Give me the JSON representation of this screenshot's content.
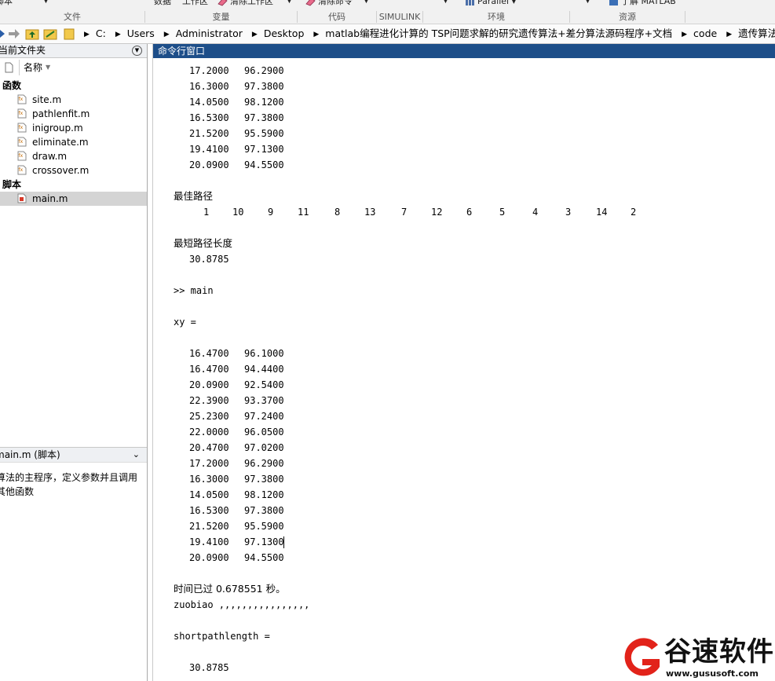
{
  "colors": {
    "accent": "#1d4e89",
    "selected": "#d4d4d4",
    "logo_red": "#e2231a"
  },
  "ribbon": {
    "items": [
      {
        "label": "脚本",
        "icon": "script-icon"
      },
      {
        "label": "数据",
        "icon": ""
      },
      {
        "label": "工作区",
        "icon": ""
      },
      {
        "label": "清除工作区",
        "icon": "eraser-icon"
      },
      {
        "label": "清除命令",
        "icon": "eraser-icon"
      },
      {
        "label": "Parallel",
        "icon": "parallel-icon"
      },
      {
        "label": "了解 MATLAB",
        "icon": "learn-icon"
      }
    ],
    "groups": [
      "文件",
      "变量",
      "代码",
      "SIMULINK",
      "环境",
      "资源"
    ]
  },
  "address": {
    "crumbs": [
      "C:",
      "Users",
      "Administrator",
      "Desktop",
      "matlab编程进化计算的 TSP问题求解的研究遗传算法+差分算法源码程序+文档",
      "code",
      "遗传算法"
    ]
  },
  "left_panel": {
    "title": "当前文件夹",
    "column": "名称",
    "groups": [
      {
        "label": "函数",
        "files": [
          "site.m",
          "pathlenfit.m",
          "inigroup.m",
          "eliminate.m",
          "draw.m",
          "crossover.m"
        ]
      },
      {
        "label": "脚本",
        "files": [
          "main.m"
        ]
      }
    ],
    "details_title": "main.m  (脚本)",
    "details_text": [
      "算法的主程序，定义参数并且调用",
      "其他函数"
    ]
  },
  "command_window": {
    "title": "命令行窗口",
    "top_rows": [
      [
        "17.2000",
        "96.2900"
      ],
      [
        "16.3000",
        "97.3800"
      ],
      [
        "14.0500",
        "98.1200"
      ],
      [
        "16.5300",
        "97.3800"
      ],
      [
        "21.5200",
        "95.5900"
      ],
      [
        "19.4100",
        "97.1300"
      ],
      [
        "20.0900",
        "94.5500"
      ]
    ],
    "best_path_label": "最佳路径",
    "best_path": [
      "1",
      "10",
      "9",
      "11",
      "8",
      "13",
      "7",
      "12",
      "6",
      "5",
      "4",
      "3",
      "14",
      "2"
    ],
    "shortest_label": "最短路径长度",
    "shortest_value": "30.8785",
    "command": ">> main",
    "xy_label": "xy =",
    "xy_rows": [
      [
        "16.4700",
        "96.1000"
      ],
      [
        "16.4700",
        "94.4400"
      ],
      [
        "20.0900",
        "92.5400"
      ],
      [
        "22.3900",
        "93.3700"
      ],
      [
        "25.2300",
        "97.2400"
      ],
      [
        "22.0000",
        "96.0500"
      ],
      [
        "20.4700",
        "97.0200"
      ],
      [
        "17.2000",
        "96.2900"
      ],
      [
        "16.3000",
        "97.3800"
      ],
      [
        "14.0500",
        "98.1200"
      ],
      [
        "16.5300",
        "97.3800"
      ],
      [
        "21.5200",
        "95.5900"
      ],
      [
        "19.4100",
        "97.1300"
      ],
      [
        "20.0900",
        "94.5500"
      ]
    ],
    "elapsed": "时间已过 0.678551 秒。",
    "zuobiao": "zuobiao ,,,,,,,,,,,,,,,,",
    "spl_label": "shortpathlength =",
    "spl_value": "30.8785"
  },
  "watermark": {
    "name": "谷速软件",
    "url": "www.gususoft.com"
  }
}
